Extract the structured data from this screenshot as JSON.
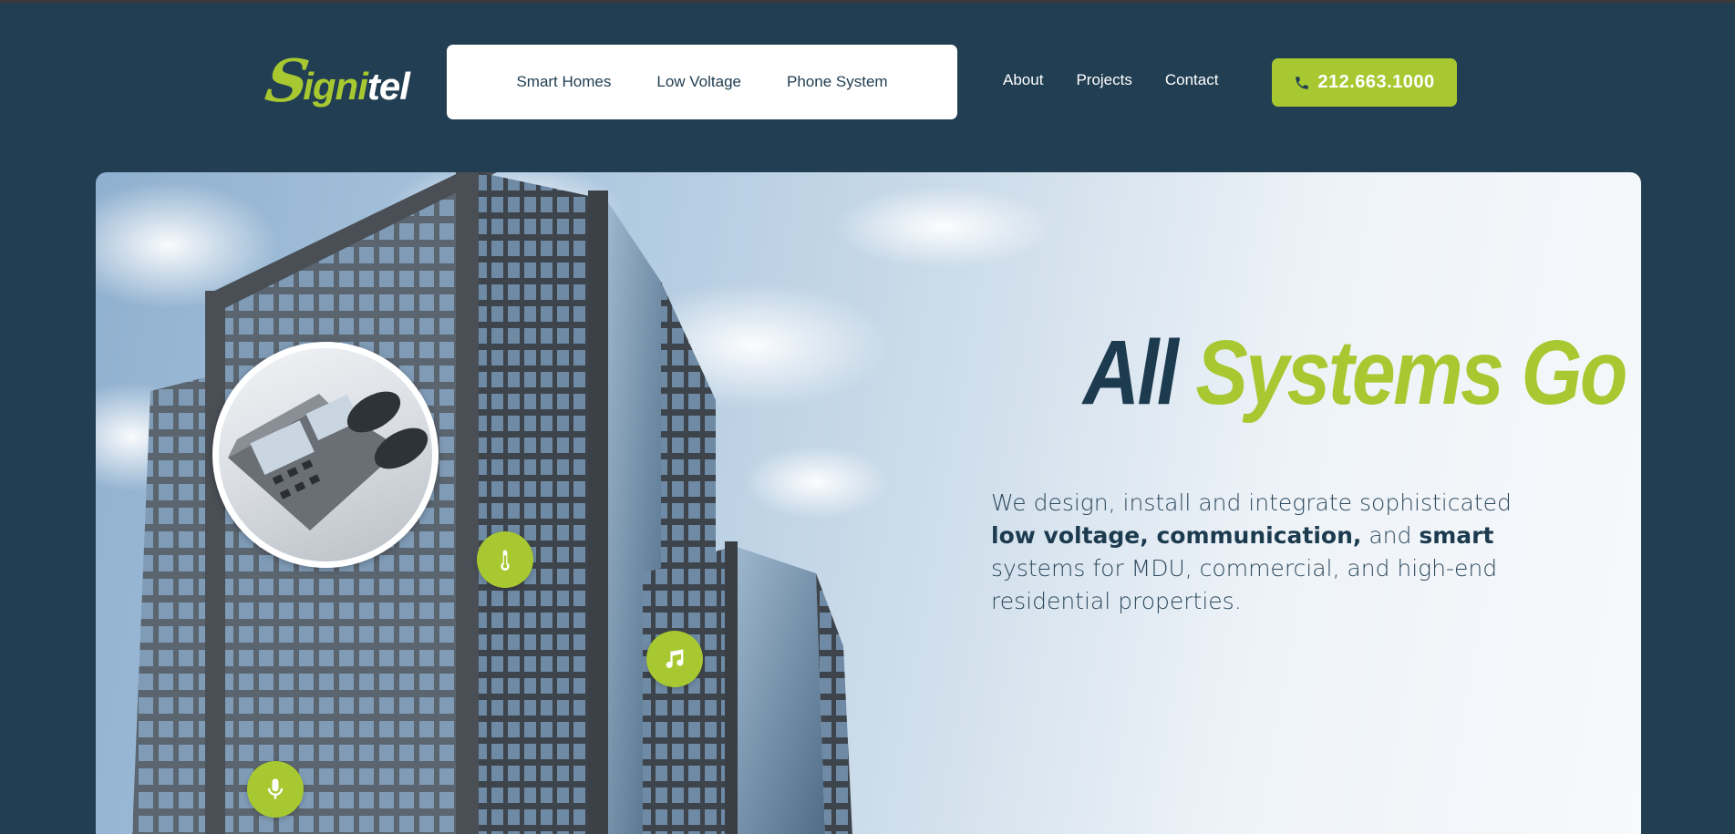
{
  "brand": {
    "logo_mark": "S",
    "logo_ign": "igni",
    "logo_tel": "tel",
    "accent_color": "#a8c832",
    "navy_color": "#213e52"
  },
  "nav": {
    "primary": [
      {
        "label": "Smart Homes"
      },
      {
        "label": "Low Voltage"
      },
      {
        "label": "Phone System"
      }
    ],
    "secondary": [
      {
        "label": "About"
      },
      {
        "label": "Projects"
      },
      {
        "label": "Contact"
      }
    ],
    "phone_label": "212.663.1000",
    "phone_icon": "phone-icon"
  },
  "hero": {
    "headline_part1": "All",
    "headline_part2": "Systems Go",
    "sub_1": "We design, install and integrate sophisticated ",
    "sub_bold_1": "low voltage, communication,",
    "sub_2": " and ",
    "sub_bold_2": "smart",
    "sub_3": " systems for MDU, commercial, and high-end residential properties.",
    "feature_icons": [
      "thermometer-icon",
      "music-icon",
      "microphone-icon"
    ]
  }
}
